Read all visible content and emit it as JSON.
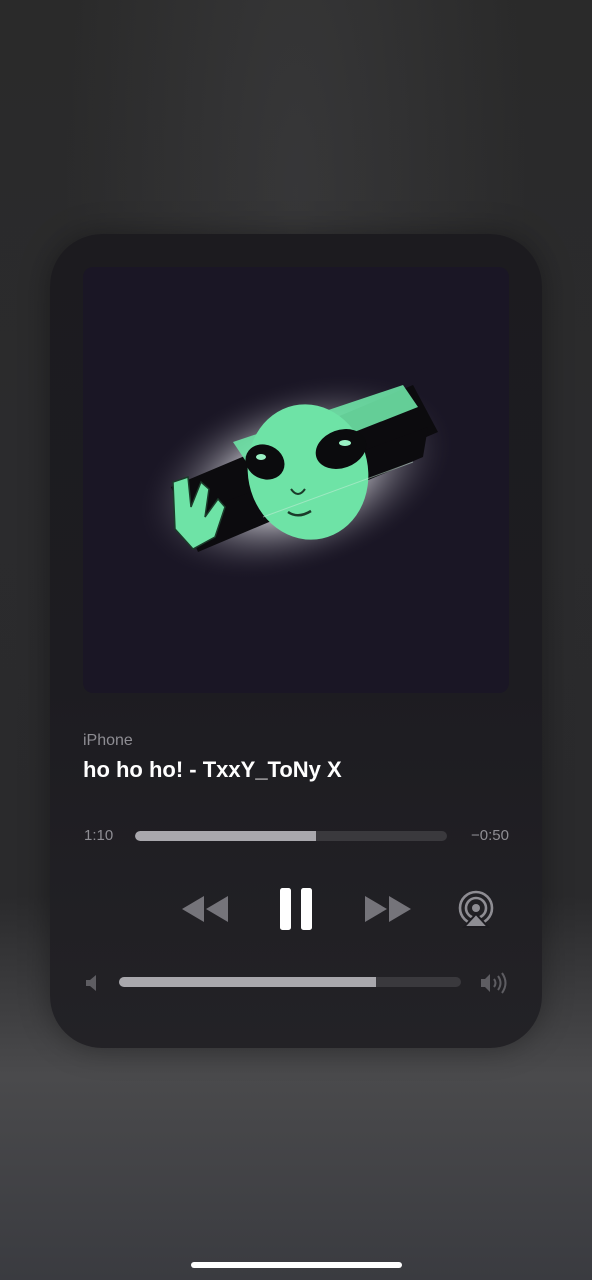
{
  "player": {
    "source": "iPhone",
    "title": "ho ho ho! - TxxY_ToNy X",
    "elapsed": "1:10",
    "remaining": "−0:50",
    "progress": 0.58,
    "volume": 0.75,
    "is_playing": true,
    "artwork_description": "alien-face-artwork"
  },
  "controls": {
    "rewind_icon": "rewind-icon",
    "pause_icon": "pause-icon",
    "forward_icon": "fast-forward-icon",
    "airplay_icon": "airplay-icon",
    "volume_low_icon": "speaker-low-icon",
    "volume_high_icon": "speaker-high-icon"
  },
  "colors": {
    "card_bg": "#1c1b1f",
    "artwork_bg": "#1a1625",
    "alien_green": "#6ee3a6",
    "track": "#3a393d",
    "fill": "#a9a8ad",
    "secondary_text": "#8e8d93"
  }
}
